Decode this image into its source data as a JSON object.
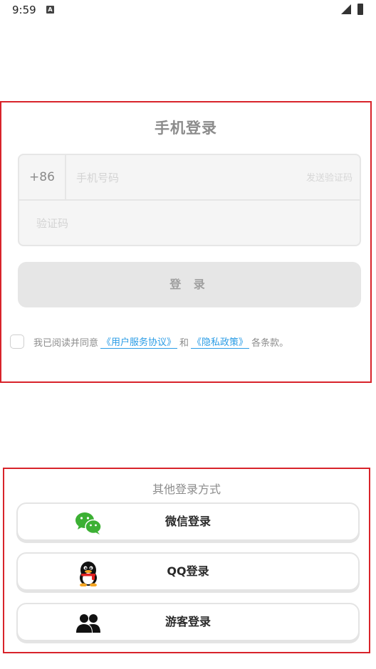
{
  "status_bar": {
    "time": "9:59",
    "notification_icon": "A"
  },
  "login": {
    "title": "手机登录",
    "country_code": "+86",
    "phone_placeholder": "手机号码",
    "send_code_label": "发送验证码",
    "code_placeholder": "验证码",
    "login_button_label": "登 录",
    "agreement": {
      "prefix": "我已阅读并同意",
      "terms_link": "《用户服务协议》",
      "conjunction": "和",
      "privacy_link": "《隐私政策》",
      "suffix": "各条款。"
    }
  },
  "other_login": {
    "title": "其他登录方式",
    "options": [
      {
        "label": "微信登录",
        "icon": "wechat-icon"
      },
      {
        "label": "QQ登录",
        "icon": "qq-icon"
      },
      {
        "label": "游客登录",
        "icon": "guest-icon"
      }
    ]
  },
  "colors": {
    "accent_link": "#2a9ce6",
    "highlight_border": "#d8232a",
    "wechat_green": "#3cb034"
  }
}
